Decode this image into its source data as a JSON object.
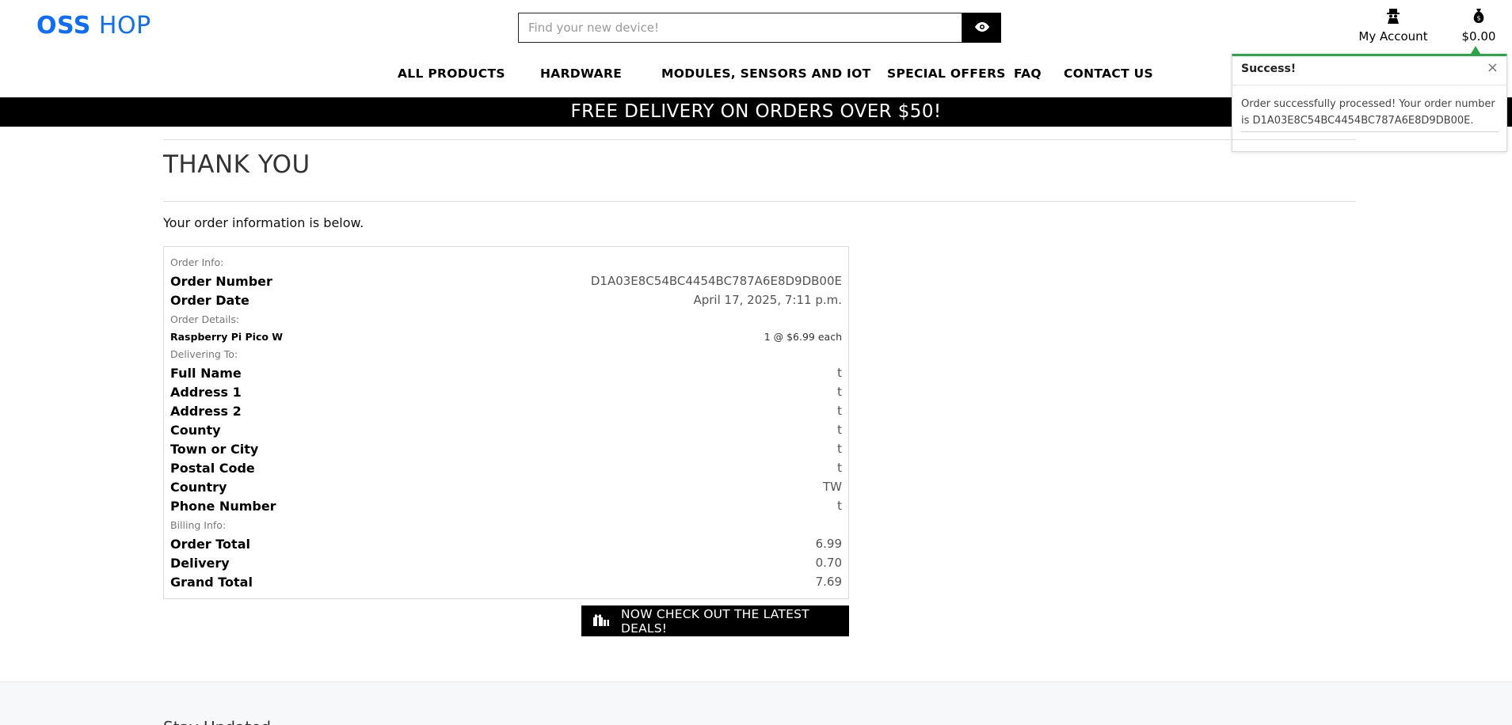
{
  "brand": {
    "logo_bold": "OSS",
    "logo_light": " HOP"
  },
  "search": {
    "placeholder": "Find your new device!"
  },
  "header": {
    "account_label": "My Account",
    "cart_total": "$0.00"
  },
  "nav": {
    "items": [
      "ALL PRODUCTS",
      "HARDWARE",
      "MODULES, SENSORS AND IOT",
      "SPECIAL OFFERS",
      "FAQ",
      "CONTACT US"
    ]
  },
  "banner": {
    "text": "FREE DELIVERY ON ORDERS OVER $50!"
  },
  "toast": {
    "title": "Success!",
    "close": "×",
    "message": "Order successfully processed! Your order number is D1A03E8C54BC4454BC787A6E8D9DB00E."
  },
  "page": {
    "title": "THANK YOU",
    "intro": "Your order information is below."
  },
  "order": {
    "order_info_label": "Order Info:",
    "order_number_label": "Order Number",
    "order_number": "D1A03E8C54BC4454BC787A6E8D9DB00E",
    "order_date_label": "Order Date",
    "order_date": "April 17, 2025, 7:11 p.m.",
    "order_details_label": "Order Details:",
    "item_name": "Raspberry Pi Pico W",
    "item_qty_price": "1 @ $6.99 each",
    "delivering_label": "Delivering To:",
    "full_name_label": "Full Name",
    "full_name": "t",
    "address1_label": "Address 1",
    "address1": "t",
    "address2_label": "Address 2",
    "address2": "t",
    "county_label": "County",
    "county": "t",
    "town_label": "Town or City",
    "town": "t",
    "postal_label": "Postal Code",
    "postal": "t",
    "country_label": "Country",
    "country": "TW",
    "phone_label": "Phone Number",
    "phone": "t",
    "billing_label": "Billing Info:",
    "order_total_label": "Order Total",
    "order_total": "6.99",
    "delivery_label": "Delivery",
    "delivery": "0.70",
    "grand_total_label": "Grand Total",
    "grand_total": "7.69"
  },
  "deals_button": {
    "label": "NOW CHECK OUT THE LATEST DEALS!"
  },
  "footer": {
    "heading": "Stay Updated"
  },
  "colors": {
    "brand": "#0d6efd",
    "success": "#28a745",
    "banner_bg": "#000000"
  }
}
